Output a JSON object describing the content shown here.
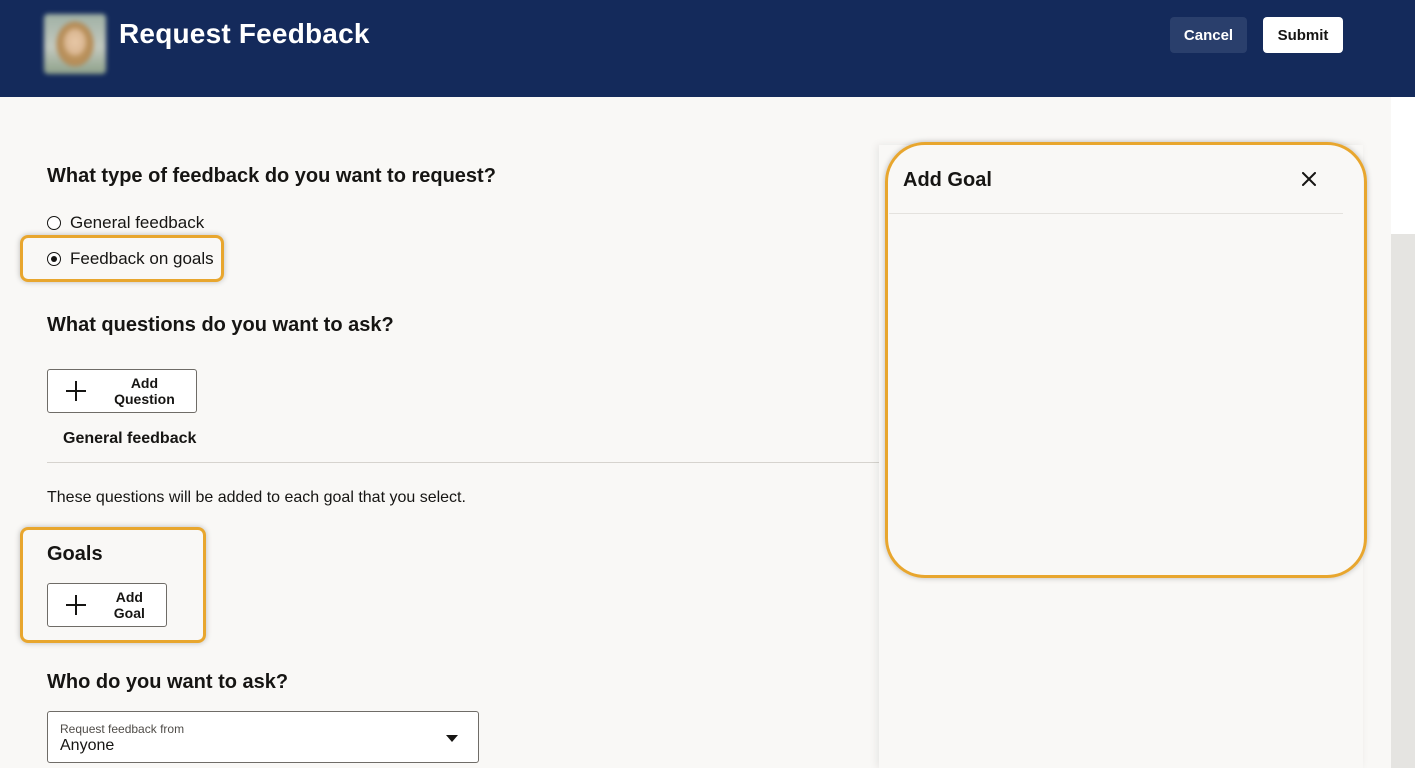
{
  "header": {
    "title": "Request Feedback",
    "cancel_label": "Cancel",
    "submit_label": "Submit",
    "background_color": "#142a5b"
  },
  "feedback_type": {
    "heading": "What type of feedback do you want to request?",
    "options": [
      {
        "label": "General feedback",
        "selected": false
      },
      {
        "label": "Feedback on goals",
        "selected": true
      }
    ]
  },
  "questions": {
    "heading": "What questions do you want to ask?",
    "add_label": "Add Question",
    "subheading": "General feedback",
    "note": "These questions will be added to each goal that you select."
  },
  "goals": {
    "heading": "Goals",
    "add_label": "Add Goal"
  },
  "who": {
    "heading": "Who do you want to ask?",
    "select_label": "Request feedback from",
    "select_value": "Anyone"
  },
  "drawer": {
    "title": "Add Goal",
    "close_icon": "close-icon"
  },
  "highlight_color": "#e8a62e"
}
